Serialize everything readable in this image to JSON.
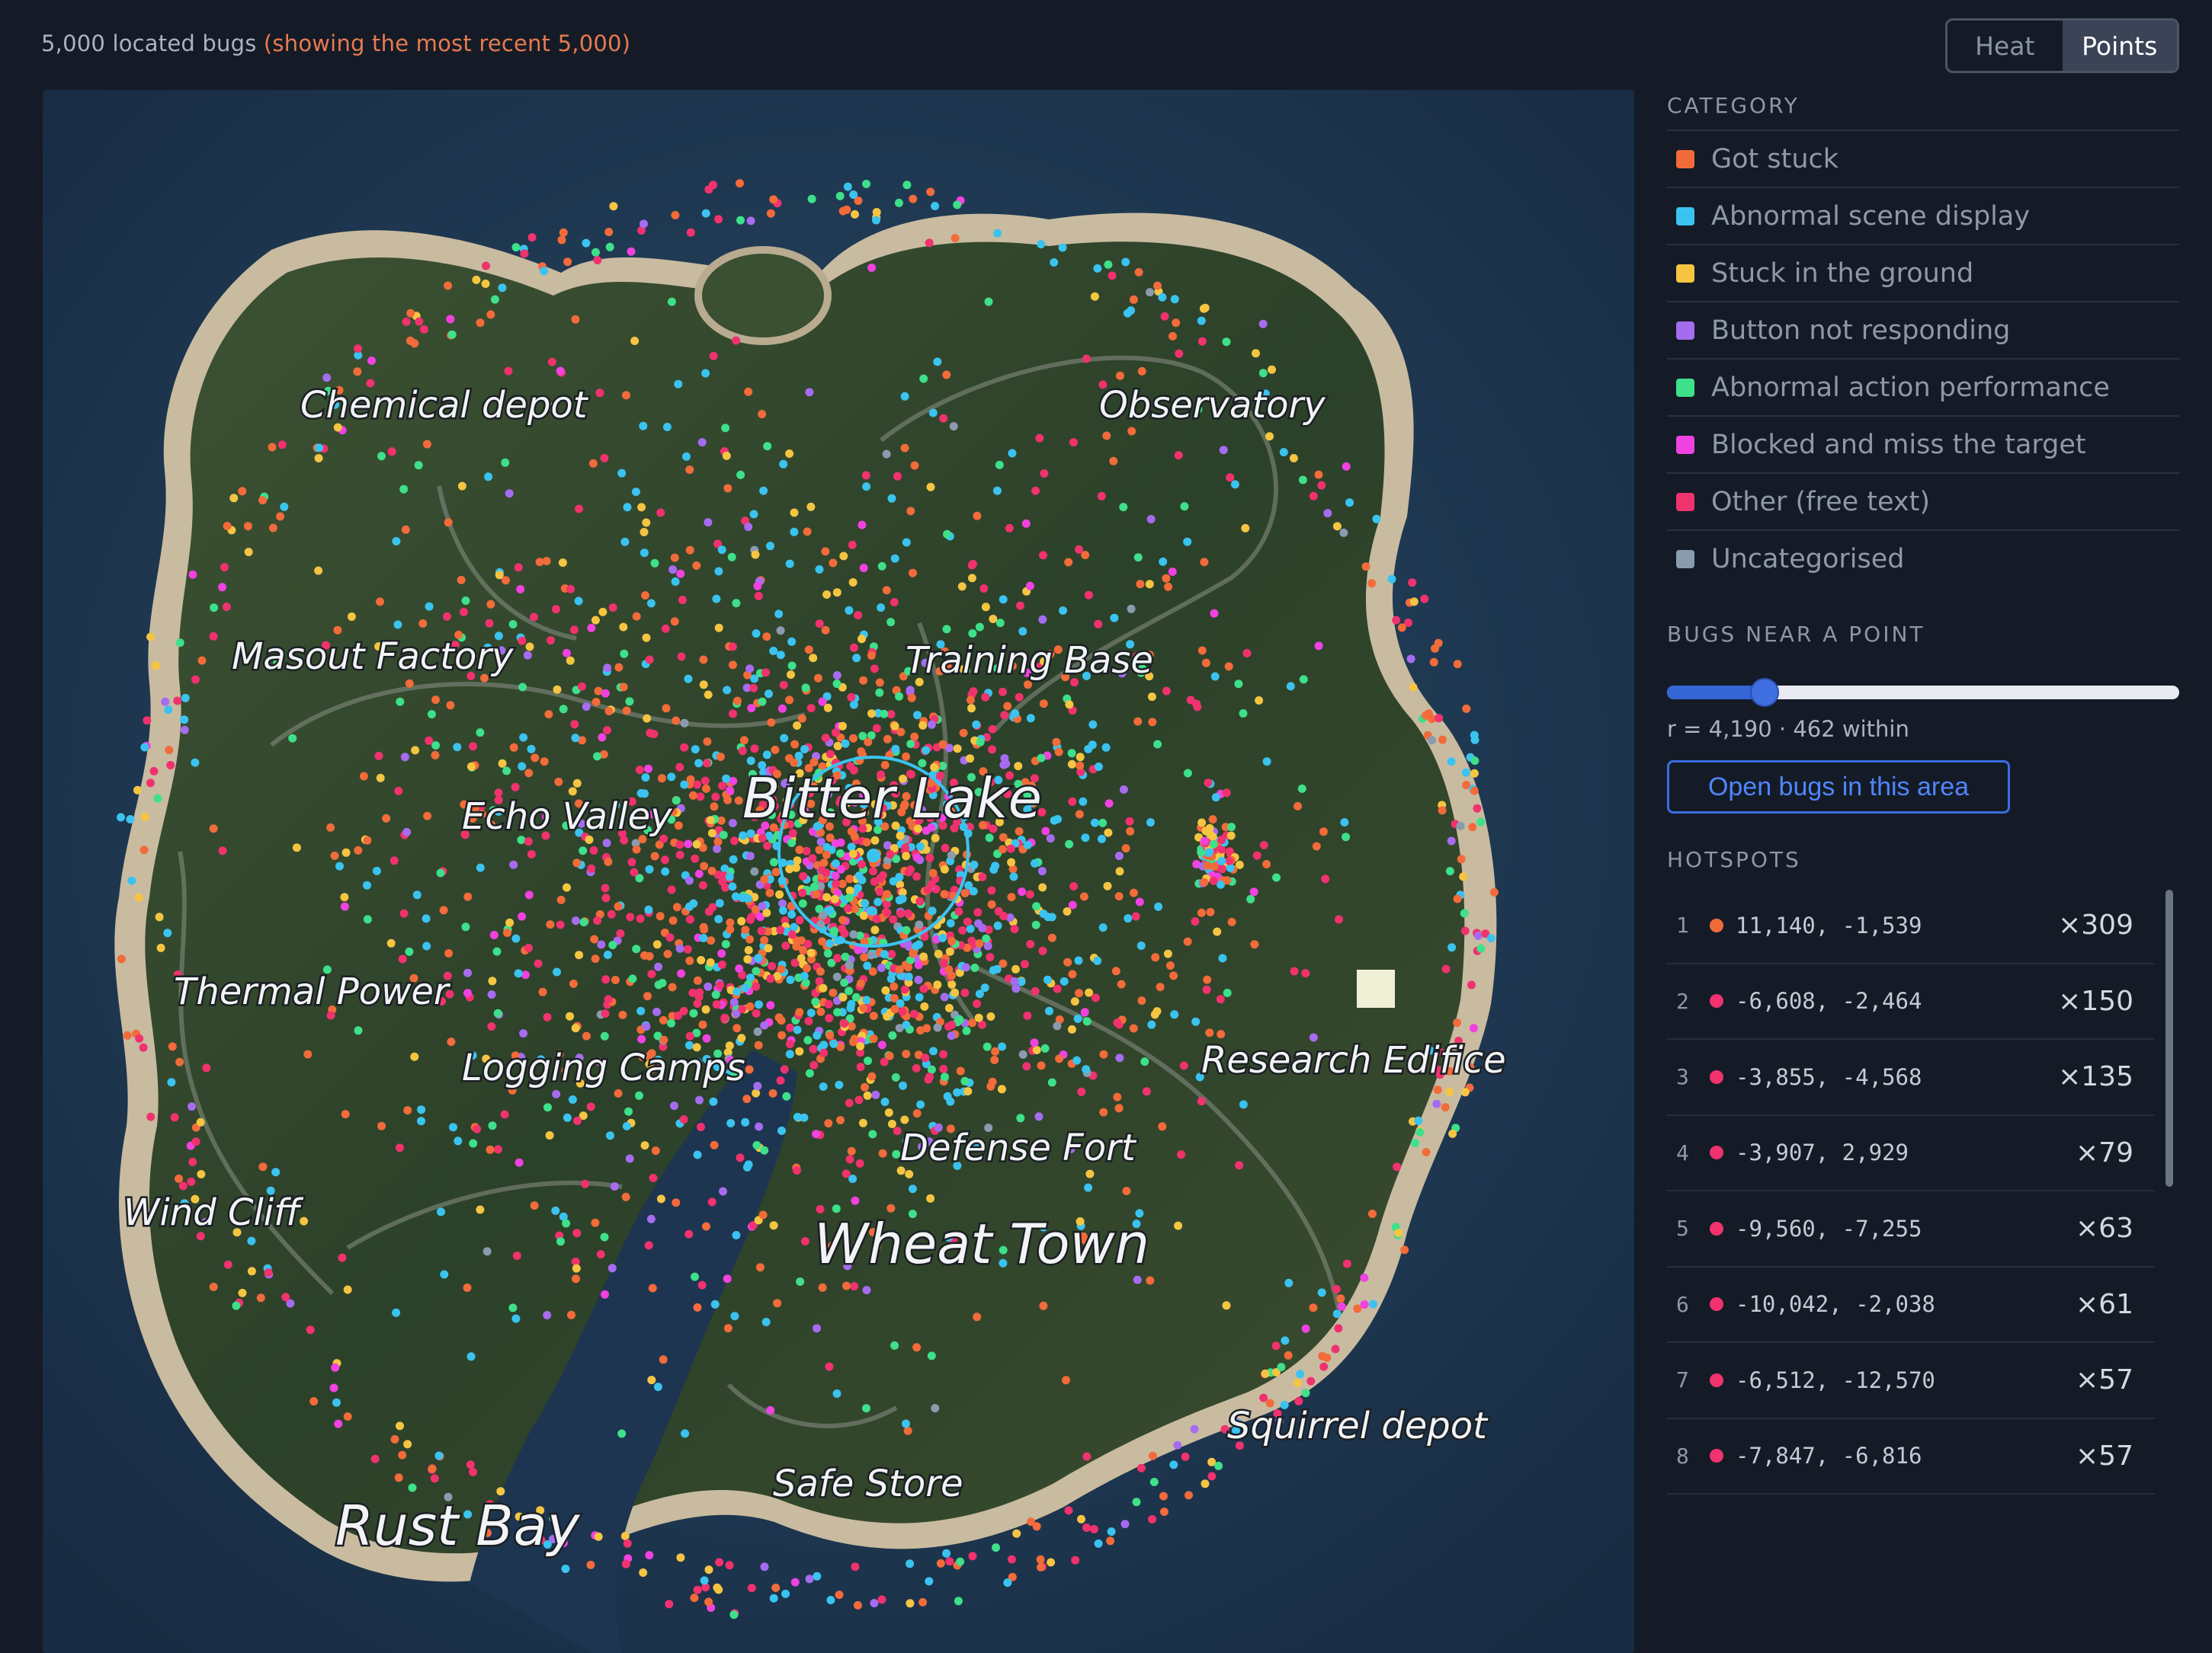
{
  "summary": {
    "count_text": "5,000 located bugs",
    "note_text": "(showing the most recent 5,000)"
  },
  "view_toggle": {
    "heat_label": "Heat",
    "points_label": "Points",
    "active": "Points"
  },
  "sidebar": {
    "category_title": "CATEGORY",
    "categories": [
      {
        "label": "Got stuck",
        "color": "#f26b3a"
      },
      {
        "label": "Abnormal scene display",
        "color": "#3bc3f0"
      },
      {
        "label": "Stuck in the ground",
        "color": "#f5c542"
      },
      {
        "label": "Button not responding",
        "color": "#a66cf0"
      },
      {
        "label": "Abnormal action performance",
        "color": "#3ee08a"
      },
      {
        "label": "Blocked and miss the target",
        "color": "#f042e0"
      },
      {
        "label": "Other (free text)",
        "color": "#f0326e"
      },
      {
        "label": "Uncategorised",
        "color": "#8a9bb0"
      }
    ],
    "near_title": "BUGS NEAR A POINT",
    "slider_value": 0.19,
    "radius_text": "r = 4,190 · 462 within",
    "open_button_label": "Open bugs in this area",
    "hotspots_title": "HOTSPOTS",
    "hotspots": [
      {
        "rank": "1",
        "coords": "11,140, -1,539",
        "count": "×309",
        "color": "#f26b3a"
      },
      {
        "rank": "2",
        "coords": "-6,608, -2,464",
        "count": "×150",
        "color": "#f0326e"
      },
      {
        "rank": "3",
        "coords": "-3,855, -4,568",
        "count": "×135",
        "color": "#f0326e"
      },
      {
        "rank": "4",
        "coords": "-3,907, 2,929",
        "count": "×79",
        "color": "#f0326e"
      },
      {
        "rank": "5",
        "coords": "-9,560, -7,255",
        "count": "×63",
        "color": "#f0326e"
      },
      {
        "rank": "6",
        "coords": "-10,042, -2,038",
        "count": "×61",
        "color": "#f0326e"
      },
      {
        "rank": "7",
        "coords": "-6,512, -12,570",
        "count": "×57",
        "color": "#f0326e"
      },
      {
        "rank": "8",
        "coords": "-7,847, -6,816",
        "count": "×57",
        "color": "#f0326e"
      }
    ]
  },
  "map": {
    "labels": [
      {
        "text": "Chemical depot"
      },
      {
        "text": "Observatory"
      },
      {
        "text": "Masout Factory"
      },
      {
        "text": "Training Base"
      },
      {
        "text": "Echo Valley"
      },
      {
        "text": "Bitter Lake"
      },
      {
        "text": "Thermal Power"
      },
      {
        "text": "Logging Camps"
      },
      {
        "text": "Research Edifice"
      },
      {
        "text": "Defense Fort"
      },
      {
        "text": "Wind Cliff"
      },
      {
        "text": "Wheat Town"
      },
      {
        "text": "Squirrel depot"
      },
      {
        "text": "Safe Store"
      },
      {
        "text": "Rust Bay"
      }
    ],
    "sea_color": "#1d3550",
    "land_color": "#31452c",
    "selection_color": "#3bc3f0"
  }
}
